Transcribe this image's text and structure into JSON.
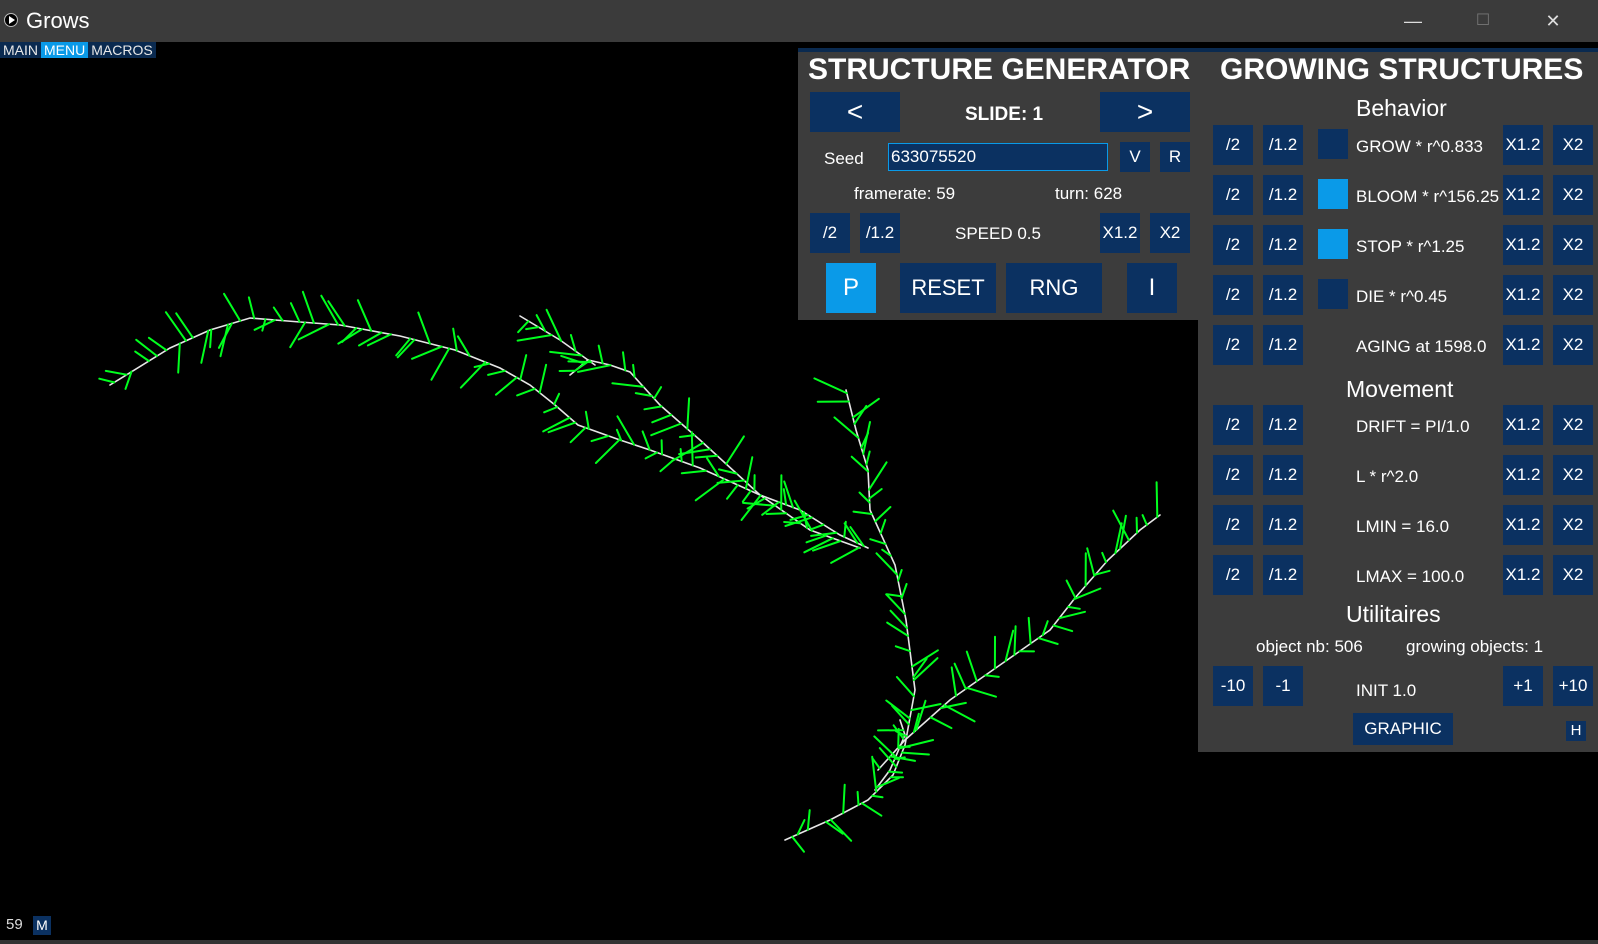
{
  "window": {
    "title": "Grows",
    "minimize": "—",
    "maximize": "☐",
    "close": "✕"
  },
  "tabs": [
    "MAIN",
    "MENU",
    "MACROS"
  ],
  "status": {
    "fps": "59",
    "menu_toggle": "M"
  },
  "colors": {
    "panel": "#3c3c3c",
    "button": "#0b3161",
    "button_active": "#0a9ae8",
    "branch": "#e6e6e6",
    "leaf": "#00ff1e"
  },
  "generator": {
    "title": "STRUCTURE GENERATOR",
    "prev": "<",
    "next": ">",
    "slide": "SLIDE: 1",
    "seed_label": "Seed",
    "seed_value": "633075520",
    "v": "V",
    "r": "R",
    "framerate": "framerate: 59",
    "turn": "turn: 628",
    "speed": {
      "div2": "/2",
      "div12": "/1.2",
      "label": "SPEED 0.5",
      "mul12": "X1.2",
      "mul2": "X2"
    },
    "p": "P",
    "reset": "RESET",
    "rng": "RNG",
    "i": "I"
  },
  "growing": {
    "title": "GROWING STRUCTURES",
    "behavior_title": "Behavior",
    "behavior_rows": [
      {
        "label": "GROW * r^0.833",
        "toggle": false
      },
      {
        "label": "BLOOM * r^156.25",
        "toggle": true
      },
      {
        "label": "STOP * r^1.25",
        "toggle": true
      },
      {
        "label": "DIE * r^0.45",
        "toggle": false
      },
      {
        "label": "AGING at 1598.0",
        "toggle": null
      }
    ],
    "movement_title": "Movement",
    "movement_rows": [
      {
        "label": "DRIFT = PI/1.0"
      },
      {
        "label": "L * r^2.0"
      },
      {
        "label": "LMIN = 16.0"
      },
      {
        "label": "LMAX = 100.0"
      }
    ],
    "btn_div2": "/2",
    "btn_div12": "/1.2",
    "btn_mul12": "X1.2",
    "btn_mul2": "X2",
    "util_title": "Utilitaires",
    "object_nb": "object nb: 506",
    "growing_objects": "growing objects: 1",
    "minus10": "-10",
    "minus1": "-1",
    "init": "INIT 1.0",
    "plus1": "+1",
    "plus10": "+10",
    "graphic": "GRAPHIC",
    "hide": "H"
  }
}
